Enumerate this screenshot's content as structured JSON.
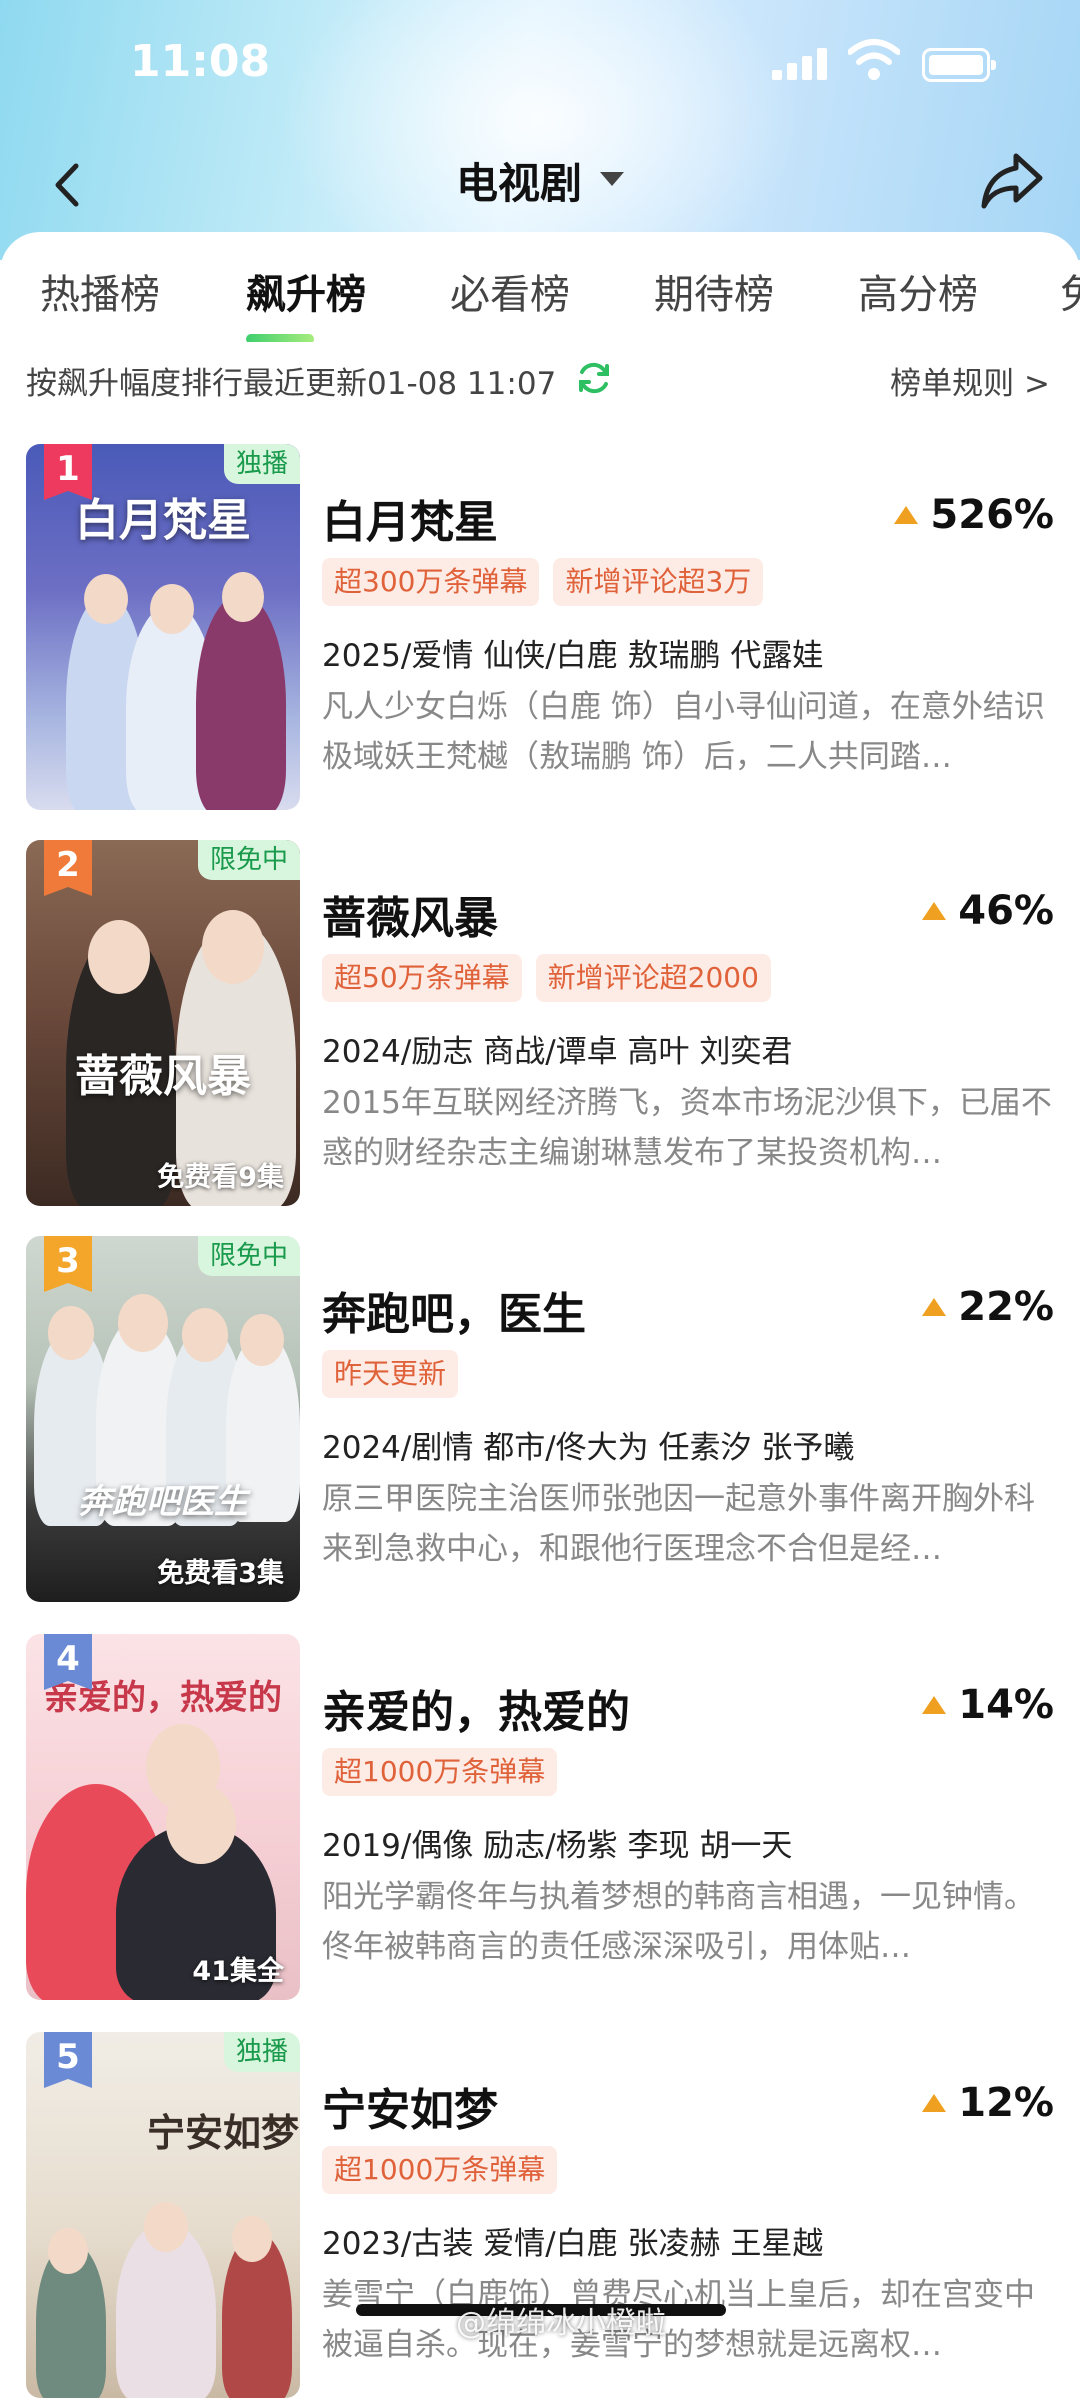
{
  "status_bar": {
    "time": "11:08"
  },
  "nav": {
    "title": "电视剧"
  },
  "tabs": [
    {
      "label": "热播榜",
      "active": false
    },
    {
      "label": "飙升榜",
      "active": true
    },
    {
      "label": "必看榜",
      "active": false
    },
    {
      "label": "期待榜",
      "active": false
    },
    {
      "label": "高分榜",
      "active": false
    },
    {
      "label": "免",
      "active": false
    }
  ],
  "subheader": {
    "update_text": "按飙升幅度排行最近更新01-08 11:07",
    "rules_label": "榜单规则 >"
  },
  "items": [
    {
      "rank": "1",
      "rank_color": "#ee3a5e",
      "poster_tag": "独播",
      "poster_title": "白月梵星",
      "poster_footer": "",
      "title": "白月梵星",
      "trend": "526%",
      "tags": [
        "超300万条弹幕",
        "新增评论超3万"
      ],
      "meta": "2025/爱情 仙侠/白鹿 敖瑞鹏 代露娃",
      "desc": "凡人少女白烁（白鹿 饰）自小寻仙问道，在意外结识极域妖王梵樾（敖瑞鹏 饰）后，二人共同踏…"
    },
    {
      "rank": "2",
      "rank_color": "#f07a3a",
      "poster_tag": "限免中",
      "poster_title": "蔷薇风暴",
      "poster_footer": "免费看9集",
      "title": "蔷薇风暴",
      "trend": "46%",
      "tags": [
        "超50万条弹幕",
        "新增评论超2000"
      ],
      "meta": "2024/励志 商战/谭卓 高叶 刘奕君",
      "desc": "2015年互联网经济腾飞，资本市场泥沙俱下，已届不惑的财经杂志主编谢琳慧发布了某投资机构…"
    },
    {
      "rank": "3",
      "rank_color": "#f4a62a",
      "poster_tag": "限免中",
      "poster_title": "奔跑吧医生",
      "poster_footer": "免费看3集",
      "title": "奔跑吧，医生",
      "trend": "22%",
      "tags": [
        "昨天更新"
      ],
      "meta": "2024/剧情 都市/佟大为 任素汐 张予曦",
      "desc": "原三甲医院主治医师张弛因一起意外事件离开胸外科来到急救中心，和跟他行医理念不合但是经…"
    },
    {
      "rank": "4",
      "rank_color": "#6b8ad6",
      "poster_tag": "",
      "poster_title": "亲爱的，热爱的",
      "poster_footer": "41集全",
      "title": "亲爱的，热爱的",
      "trend": "14%",
      "tags": [
        "超1000万条弹幕"
      ],
      "meta": "2019/偶像 励志/杨紫 李现 胡一天",
      "desc": "阳光学霸佟年与执着梦想的韩商言相遇，一见钟情。佟年被韩商言的责任感深深吸引，用体贴…"
    },
    {
      "rank": "5",
      "rank_color": "#6b8ad6",
      "poster_tag": "独播",
      "poster_title": "宁安如梦",
      "poster_footer": "",
      "title": "宁安如梦",
      "trend": "12%",
      "tags": [
        "超1000万条弹幕"
      ],
      "meta": "2023/古装 爱情/白鹿 张凌赫 王星越",
      "desc": "姜雪宁（白鹿饰）曾费尽心机当上皇后，却在宫变中被逼自杀。现在，姜雪宁的梦想就是远离权…"
    }
  ],
  "watermark": "@绵绵冰小橙啦"
}
